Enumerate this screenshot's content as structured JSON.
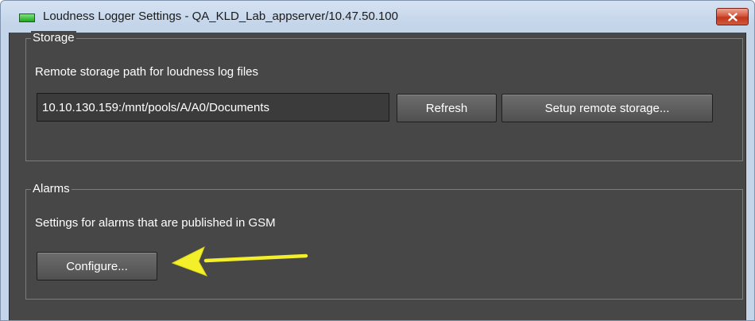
{
  "window": {
    "title": "Loudness Logger Settings - QA_KLD_Lab_appserver/10.47.50.100",
    "app_icon": "green-display-icon",
    "close_icon": "close-icon",
    "close_color": "#c94a2f"
  },
  "storage": {
    "legend": "Storage",
    "description": "Remote storage path for loudness log files",
    "path_value": "10.10.130.159:/mnt/pools/A/A0/Documents",
    "refresh_label": "Refresh",
    "setup_label": "Setup remote storage..."
  },
  "alarms": {
    "legend": "Alarms",
    "description": "Settings for alarms that are published in GSM",
    "configure_label": "Configure..."
  },
  "annotation": {
    "arrow_icon": "arrow-left-icon",
    "arrow_color": "#f3ef2a"
  },
  "colors": {
    "panel_background": "#474747",
    "titlebar": "#c4d5ea",
    "text": "#ffffff"
  }
}
